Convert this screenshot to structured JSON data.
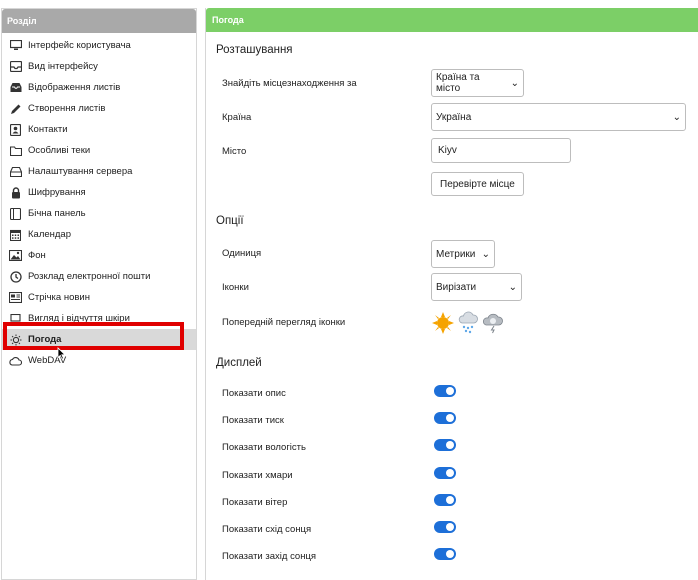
{
  "sidebar": {
    "header": "Розділ",
    "items": [
      {
        "label": "Інтерфейс користувача",
        "icon": "monitor-icon"
      },
      {
        "label": "Вид інтерфейсу",
        "icon": "inbox-icon"
      },
      {
        "label": "Відображення листів",
        "icon": "inbox-icon"
      },
      {
        "label": "Створення листів",
        "icon": "pencil-icon"
      },
      {
        "label": "Контакти",
        "icon": "contact-card-icon"
      },
      {
        "label": "Особливі теки",
        "icon": "folder-icon"
      },
      {
        "label": "Налаштування сервера",
        "icon": "server-icon"
      },
      {
        "label": "Шифрування",
        "icon": "lock-icon"
      },
      {
        "label": "Бічна панель",
        "icon": "panel-icon"
      },
      {
        "label": "Календар",
        "icon": "calendar-icon"
      },
      {
        "label": "Фон",
        "icon": "image-icon"
      },
      {
        "label": "Розклад електронної пошти",
        "icon": "clock-icon"
      },
      {
        "label": "Стрічка новин",
        "icon": "newspaper-icon"
      },
      {
        "label": "Вигляд і відчуття шкіри",
        "icon": "laptop-icon"
      },
      {
        "label": "Погода",
        "icon": "sun-icon",
        "active": true
      },
      {
        "label": "WebDAV",
        "icon": "cloud-icon"
      }
    ]
  },
  "main": {
    "header": "Погода",
    "location": {
      "title": "Розташування",
      "find_label": "Знайдіть місцезнаходження за",
      "find_value": "Країна та місто",
      "country_label": "Країна",
      "country_value": "Україна",
      "city_label": "Місто",
      "city_value": "Kiyv",
      "check_button": "Перевірте місце"
    },
    "options": {
      "title": "Опції",
      "unit_label": "Одиниця",
      "unit_value": "Метрики",
      "icons_label": "Іконки",
      "icons_value": "Вирізати",
      "preview_label": "Попередній перегляд іконки"
    },
    "display": {
      "title": "Дисплей",
      "toggles": [
        {
          "label": "Показати опис",
          "on": true
        },
        {
          "label": "Показати тиск",
          "on": true
        },
        {
          "label": "Показати вологість",
          "on": true
        },
        {
          "label": "Показати хмари",
          "on": true
        },
        {
          "label": "Показати вітер",
          "on": true
        },
        {
          "label": "Показати схід сонця",
          "on": true
        },
        {
          "label": "Показати захід сонця",
          "on": true
        }
      ]
    }
  },
  "colors": {
    "accent_green": "#7ccf67",
    "toggle_blue": "#1d6fd8",
    "highlight_red": "#e00000",
    "sidebar_header": "#a9a9a9"
  }
}
